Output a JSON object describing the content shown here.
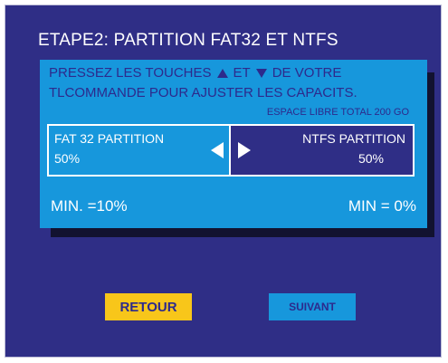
{
  "title": "ETAPE2: PARTITION FAT32 ET NTFS",
  "instructions": {
    "line1_before": "PRESSEZ LES TOUCHES",
    "line1_middle": "ET",
    "line1_after": "DE VOTRE",
    "line2": "TLCOMMANDE POUR AJUSTER LES CAPACITS.",
    "up_icon": "triangle-up-icon",
    "down_icon": "triangle-down-icon"
  },
  "free_space": "ESPACE LIBRE TOTAL 200 GO",
  "partitions": {
    "fat32": {
      "label": "FAT 32 PARTITION",
      "percent": "50%"
    },
    "ntfs": {
      "label": "NTFS PARTITION",
      "percent": "50%"
    },
    "split_fraction": 0.5
  },
  "limits": {
    "fat32_min": "MIN. =10%",
    "ntfs_min": "MIN = 0%"
  },
  "buttons": {
    "back": "RETOUR",
    "next": "SUIVANT"
  },
  "colors": {
    "background": "#2f2e86",
    "panel": "#1797dc",
    "text_dark": "#2d2a8c",
    "back_button": "#f8c61a"
  }
}
